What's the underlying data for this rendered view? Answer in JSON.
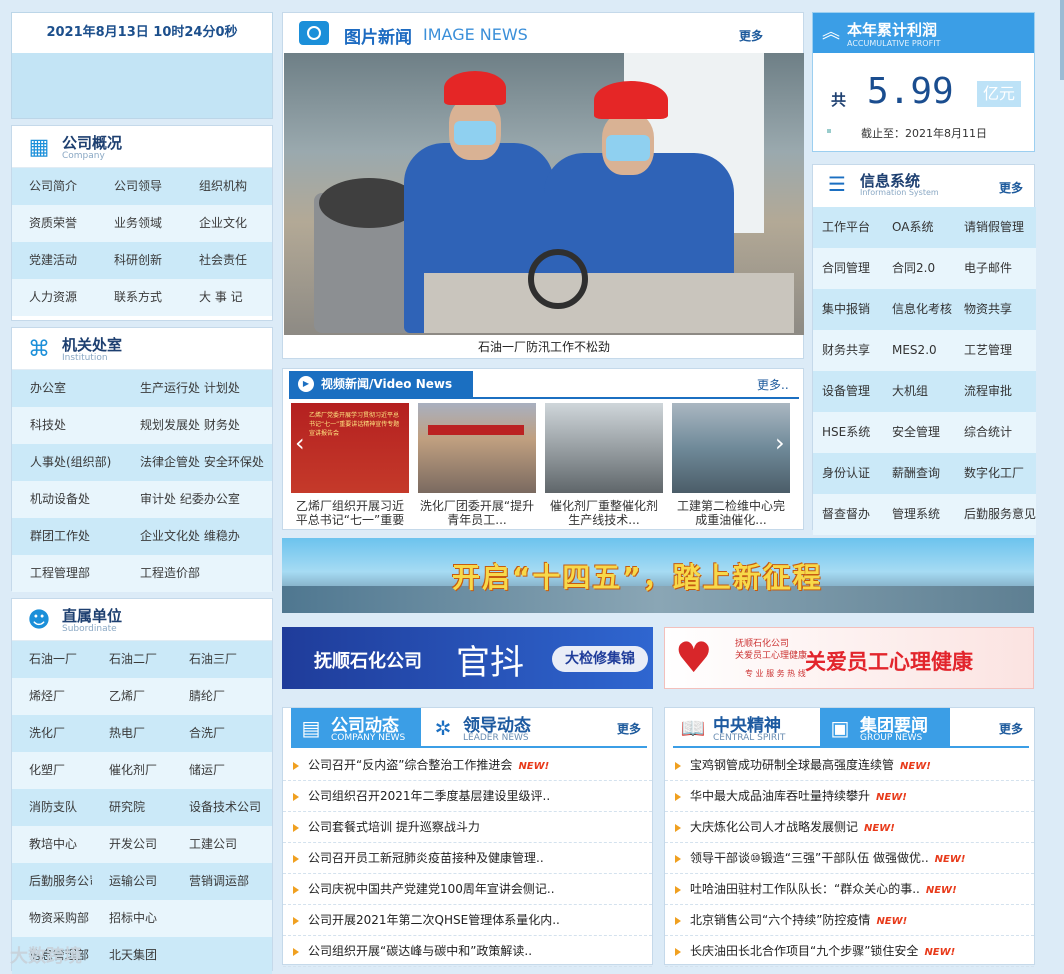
{
  "datetime": "2021年8月13日  10时24分0秒",
  "company_overview": {
    "title": "公司概况",
    "subtitle": "Company",
    "items": [
      "公司简介",
      "公司领导",
      "组织机构",
      "资质荣誉",
      "业务领域",
      "企业文化",
      "党建活动",
      "科研创新",
      "社会责任",
      "人力资源",
      "联系方式",
      "大 事 记"
    ]
  },
  "departments": {
    "title": "机关处室",
    "subtitle": "Institution",
    "items": [
      "办公室",
      "生产运行处 计划处",
      "科技处",
      "规划发展处 财务处",
      "人事处(组织部)",
      "法律企管处 安全环保处",
      "机动设备处",
      "审计处    纪委办公室",
      "群团工作处",
      "企业文化处 维稳办",
      "工程管理部",
      "工程造价部"
    ]
  },
  "subordinate": {
    "title": "直属单位",
    "subtitle": "Subordinate",
    "items": [
      "石油一厂",
      "石油二厂",
      "石油三厂",
      "烯烃厂",
      "乙烯厂",
      "腈纶厂",
      "洗化厂",
      "热电厂",
      "合洗厂",
      "化塑厂",
      "催化剂厂",
      "储运厂",
      "消防支队",
      "研究院",
      "设备技术公司",
      "教培中心",
      "开发公司",
      "工建公司",
      "后勤服务公司",
      "运输公司",
      "营销调运部",
      "物资采购部",
      "招标中心",
      "",
      "信息管理部",
      "北天集团",
      ""
    ]
  },
  "image_news": {
    "title_cn": "图片新闻",
    "title_en": "IMAGE NEWS",
    "more": "更多",
    "caption": "石油一厂防汛工作不松劲"
  },
  "video_news": {
    "title": "视频新闻/Video News",
    "more": "更多..",
    "items": [
      {
        "caption": "乙烯厂组织开展习近平总书记“七一”重要讲话"
      },
      {
        "caption": "洗化厂团委开展“提升青年员工..."
      },
      {
        "caption": "催化剂厂重整催化剂生产线技术..."
      },
      {
        "caption": "工建第二检维中心完成重油催化..."
      }
    ],
    "thumb_text": "乙烯厂党委开展学习贯彻习近平总书记“七一”重要讲话精神宣传专题宣讲报告会"
  },
  "banner1": {
    "text": "开启“十四五”，踏上新征程"
  },
  "banner2": {
    "left": "抚顺石化公司",
    "middle": "官抖",
    "right": "大检修集锦"
  },
  "banner3": {
    "small1": "抚顺石化公司",
    "small2": "关爱员工心理健康",
    "small3": "专 业 服 务 热 线",
    "main": "关爱员工心理健康"
  },
  "company_news": {
    "tab1_cn": "公司动态",
    "tab1_en": "COMPANY NEWS",
    "tab2_cn": "领导动态",
    "tab2_en": "LEADER NEWS",
    "more": "更多",
    "items": [
      {
        "text": "公司召开“反内盗”综合整治工作推进会",
        "badge": "NEW!"
      },
      {
        "text": "公司组织召开2021年二季度基层建设里级评..",
        "badge": ""
      },
      {
        "text": "公司套餐式培训 提升巡察战斗力",
        "badge": ""
      },
      {
        "text": "公司召开员工新冠肺炎疫苗接种及健康管理..",
        "badge": ""
      },
      {
        "text": "公司庆祝中国共产党建党100周年宣讲会侧记..",
        "badge": ""
      },
      {
        "text": "公司开展2021年第二次QHSE管理体系量化内..",
        "badge": ""
      },
      {
        "text": "公司组织开展“碳达峰与碳中和”政策解读..",
        "badge": ""
      }
    ]
  },
  "central_news": {
    "tab1_cn": "中央精神",
    "tab1_en": "CENTRAL SPIRIT",
    "tab2_cn": "集团要闻",
    "tab2_en": "GROUP NEWS",
    "more": "更多",
    "items": [
      {
        "text": "宝鸡钢管成功研制全球最高强度连续管",
        "badge": "NEW!"
      },
      {
        "text": "华中最大成品油库吞吐量持续攀升",
        "badge": "NEW!"
      },
      {
        "text": "大庆炼化公司人才战略发展侧记",
        "badge": "NEW!"
      },
      {
        "text": "领导干部谈⑩锻造“三强”干部队伍 做强做优..",
        "badge": "NEW!"
      },
      {
        "text": "吐哈油田驻村工作队队长：“群众关心的事..",
        "badge": "NEW!"
      },
      {
        "text": "北京销售公司“六个持续”防控疫情",
        "badge": "NEW!"
      },
      {
        "text": "长庆油田长北合作项目“九个步骤”锁住安全",
        "badge": "NEW!"
      }
    ]
  },
  "profit": {
    "title": "本年累计利润",
    "subtitle": "ACCUMULATIVE PROFIT",
    "prefix": "共",
    "value": "5.99",
    "unit": "亿元",
    "date": "截止至：2021年8月11日"
  },
  "info_system": {
    "title": "信息系统",
    "subtitle": "Information System",
    "more": "更多",
    "items": [
      "工作平台",
      "OA系统",
      "请销假管理",
      "合同管理",
      "合同2.0",
      "电子邮件",
      "集中报销",
      "信息化考核",
      "物资共享",
      "财务共享",
      "MES2.0",
      "工艺管理",
      "设备管理",
      "大机组",
      "流程审批",
      "HSE系统",
      "安全管理",
      "综合统计",
      "身份认证",
      "薪酬查询",
      "数字化工厂",
      "督查督办",
      "管理系统",
      "后勤服务意见"
    ]
  },
  "watermark": "大数跨境",
  "colors": {
    "primary": "#1b6fc1",
    "accent": "#3b9ee6",
    "light": "#cbe9f8",
    "new_badge": "#e83a1a"
  }
}
